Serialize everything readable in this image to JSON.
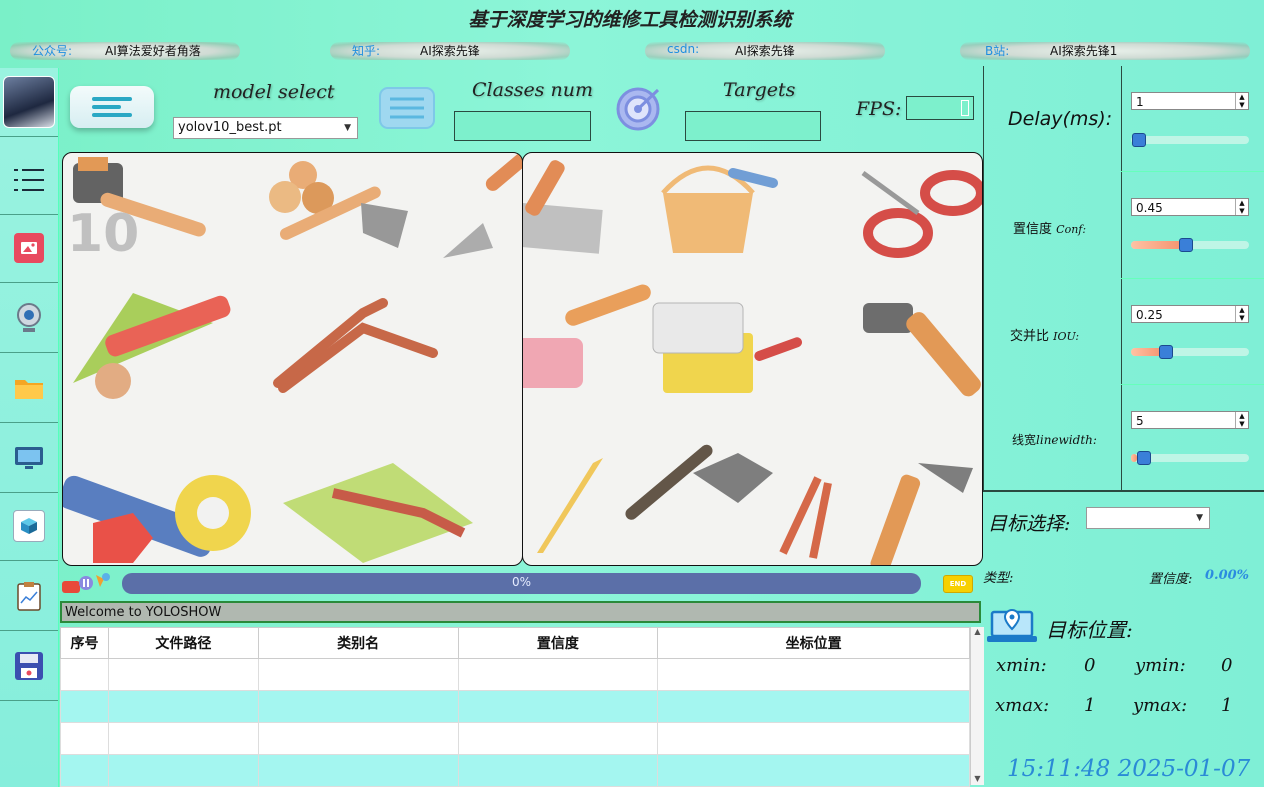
{
  "window": {
    "title": "基于深度学习的维修工具检测识别系统"
  },
  "infobar": [
    {
      "label": "公众号:",
      "value": "AI算法爱好者角落"
    },
    {
      "label": "知乎:",
      "value": "AI探索先锋"
    },
    {
      "label": "csdn:",
      "value": "AI探索先锋"
    },
    {
      "label": "B站:",
      "value": "AI探索先锋1"
    }
  ],
  "header": {
    "model_select_label": "model select",
    "model_value": "yolov10_best.pt",
    "classes_label": "Classes num",
    "targets_label": "Targets",
    "fps_label": "FPS:",
    "classes_value": "",
    "targets_value": "",
    "fps_value": ""
  },
  "sidebar": {
    "items": [
      "avatar",
      "menu-icon",
      "image-icon",
      "camera-icon",
      "folder-icon",
      "screen-cast-icon",
      "cube-icon",
      "report-icon",
      "save-icon"
    ]
  },
  "progress": {
    "value": 0,
    "text": "0%"
  },
  "status": {
    "text": "Welcome to YOLOSHOW"
  },
  "table": {
    "headers": [
      "序号",
      "文件路径",
      "类别名",
      "置信度",
      "坐标位置"
    ],
    "rows": 4
  },
  "settings": {
    "delay": {
      "label": "Delay(ms):",
      "value": "1",
      "slider": 0.0
    },
    "conf": {
      "label_cn": "置信度",
      "label_en": "Conf:",
      "value": "0.45",
      "slider": 0.45
    },
    "iou": {
      "label_cn": "交并比",
      "label_en": "IOU:",
      "value": "0.25",
      "slider": 0.25
    },
    "linewidth": {
      "label_cn": "线宽",
      "label_en": "linewidth:",
      "value": "5",
      "slider": 0.05
    }
  },
  "target": {
    "select_label": "目标选择:",
    "select_value": "",
    "type_label": "类型:",
    "type_value": "",
    "conf_label": "置信度:",
    "conf_value": "0.00%",
    "pos_title": "目标位置:",
    "xmin_label": "xmin:",
    "xmin": "0",
    "ymin_label": "ymin:",
    "ymin": "0",
    "xmax_label": "xmax:",
    "xmax": "1",
    "ymax_label": "ymax:",
    "ymax": "1"
  },
  "clock": "15:11:48 2025-01-07",
  "end_badge": "END",
  "colors": {
    "accent": "#1e8fe0",
    "progress": "#5b6fa8",
    "status_bg": "#b0b8b0",
    "conf_value": "#2b8be0"
  }
}
